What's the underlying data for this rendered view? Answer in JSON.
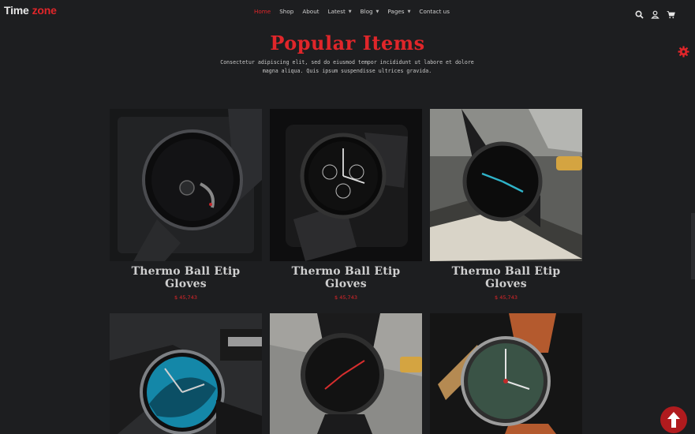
{
  "brand": {
    "part1": "Time",
    "part2": "zone"
  },
  "nav": [
    {
      "label": "Home",
      "active": true,
      "dropdown": false
    },
    {
      "label": "Shop",
      "active": false,
      "dropdown": false
    },
    {
      "label": "About",
      "active": false,
      "dropdown": false
    },
    {
      "label": "Latest",
      "active": false,
      "dropdown": true
    },
    {
      "label": "Blog",
      "active": false,
      "dropdown": true
    },
    {
      "label": "Pages",
      "active": false,
      "dropdown": true
    },
    {
      "label": "Contact us",
      "active": false,
      "dropdown": false
    }
  ],
  "header_icons": [
    "search-icon",
    "user-icon",
    "cart-icon"
  ],
  "section": {
    "title": "Popular Items",
    "subtitle": "Consectetur adipiscing elit, sed do eiusmod tempor incididunt ut labore et dolore magna aliqua. Quis ipsum suspendisse ultrices gravida."
  },
  "products": [
    {
      "name": "Thermo Ball Etip Gloves",
      "price": "$ 45,743"
    },
    {
      "name": "Thermo Ball Etip Gloves",
      "price": "$ 45,743"
    },
    {
      "name": "Thermo Ball Etip Gloves",
      "price": "$ 45,743"
    },
    {
      "name": "",
      "price": ""
    },
    {
      "name": "",
      "price": ""
    },
    {
      "name": "",
      "price": ""
    }
  ],
  "colors": {
    "accent": "#e0262a",
    "background": "#1d1e20"
  }
}
